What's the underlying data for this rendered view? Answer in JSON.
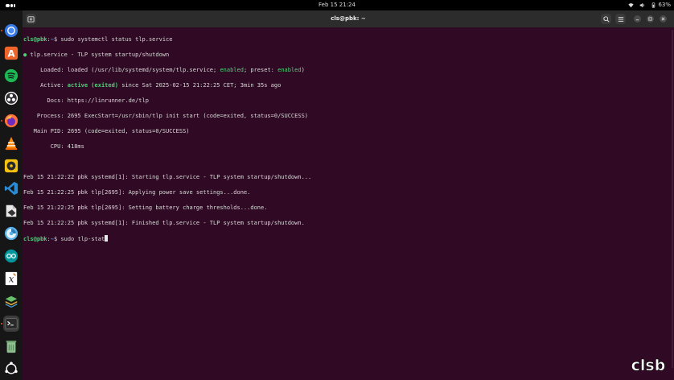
{
  "topbar": {
    "clock": "Feb 15  21:24",
    "battery": "63%"
  },
  "dock": {
    "apps": [
      {
        "name": "chromium",
        "color": "#4a8af4"
      },
      {
        "name": "software-center",
        "color": "#f0652b"
      },
      {
        "name": "spotify",
        "color": "#1db954"
      },
      {
        "name": "obs-studio",
        "color": "#ffffff"
      },
      {
        "name": "firefox",
        "color": "#ff7139"
      },
      {
        "name": "vlc",
        "color": "#ff8800"
      },
      {
        "name": "rhythmbox",
        "color": "#f5c211"
      },
      {
        "name": "vscode",
        "color": "#2a8bd6"
      },
      {
        "name": "libreoffice",
        "color": "#dddddd"
      },
      {
        "name": "disk-usage",
        "color": "#5ab0e8"
      },
      {
        "name": "arduino",
        "color": "#00979c"
      },
      {
        "name": "xournal",
        "color": "#ffffff"
      },
      {
        "name": "layers",
        "color": "#6ac06a"
      },
      {
        "name": "terminal",
        "color": "#444444"
      },
      {
        "name": "trash",
        "color": "#8fbf8f"
      },
      {
        "name": "show-apps",
        "color": "#ffffff"
      }
    ]
  },
  "window": {
    "title": "cls@pbk: ~"
  },
  "terminal": {
    "prompt1": "cls@pbk",
    "prompt_sep1": ":",
    "prompt_path1": "~",
    "prompt_sym1": "$ ",
    "cmd1": "sudo systemctl status tlp.service",
    "status_dot": "●",
    "unit_line": " tlp.service - TLP system startup/shutdown",
    "loaded_pre": "     Loaded: loaded (/usr/lib/systemd/system/tlp.service; ",
    "loaded_enabled": "enabled",
    "loaded_mid": "; preset: ",
    "loaded_preset": "enabled",
    "loaded_post": ")",
    "active_pre": "     Active: ",
    "active_state": "active (exited)",
    "active_post": " since Sat 2025-02-15 21:22:25 CET; 3min 35s ago",
    "docs": "       Docs: https://linrunner.de/tlp",
    "process": "    Process: 2695 ExecStart=/usr/sbin/tlp init start (code=exited, status=0/SUCCESS)",
    "mainpid": "   Main PID: 2695 (code=exited, status=0/SUCCESS)",
    "cpu": "        CPU: 418ms",
    "log1": "Feb 15 21:22:22 pbk systemd[1]: Starting tlp.service - TLP system startup/shutdown...",
    "log2": "Feb 15 21:22:25 pbk tlp[2695]: Applying power save settings...done.",
    "log3": "Feb 15 21:22:25 pbk tlp[2695]: Setting battery charge thresholds...done.",
    "log4": "Feb 15 21:22:25 pbk systemd[1]: Finished tlp.service - TLP system startup/shutdown.",
    "prompt2": "cls@pbk",
    "prompt_sep2": ":",
    "prompt_path2": "~",
    "prompt_sym2": "$ ",
    "cmd2": "sudo tlp-stat"
  },
  "watermark": "clsb"
}
